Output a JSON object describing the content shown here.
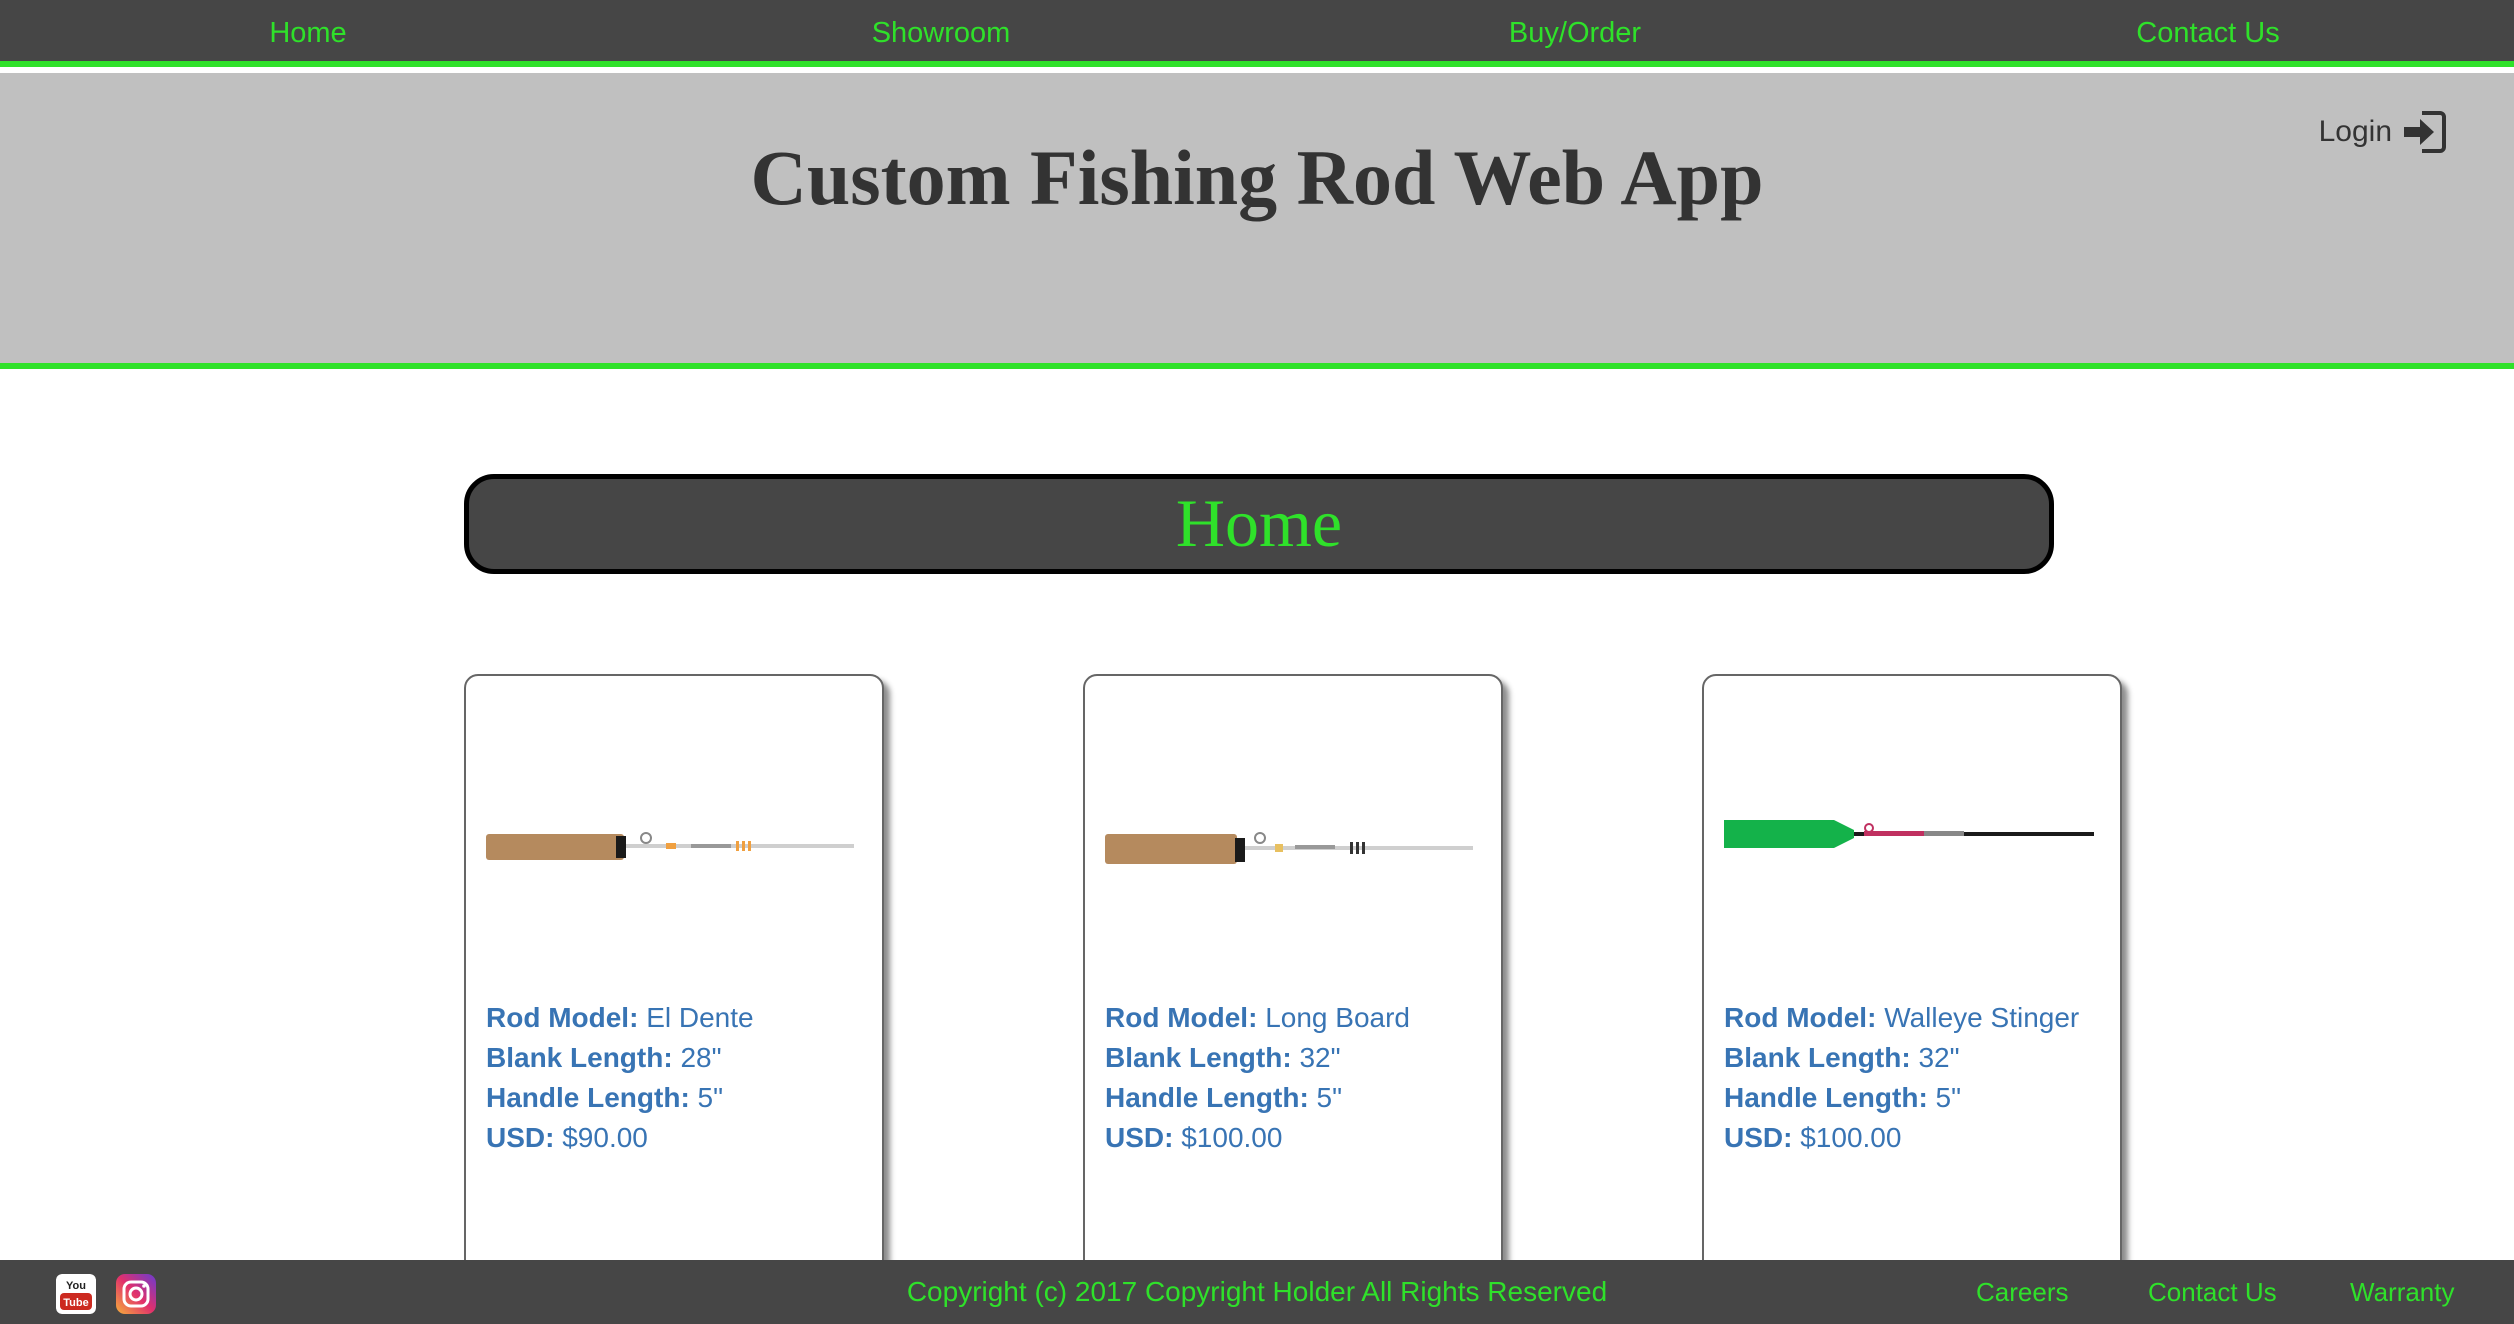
{
  "nav": {
    "home": "Home",
    "showroom": "Showroom",
    "buy_order": "Buy/Order",
    "contact": "Contact Us"
  },
  "header": {
    "title": "Custom Fishing Rod Web App",
    "login_label": "Login",
    "login_icon": "sign-in-icon"
  },
  "page": {
    "heading": "Home"
  },
  "labels": {
    "model": "Rod Model:",
    "blank": "Blank Length:",
    "handle": "Handle Length:",
    "usd": "USD:"
  },
  "products": [
    {
      "model": "El Dente",
      "blank_length": "28\"",
      "handle_length": "5\"",
      "price": "$90.00",
      "handle_style": "cork"
    },
    {
      "model": "Long Board",
      "blank_length": "32\"",
      "handle_length": "5\"",
      "price": "$100.00",
      "handle_style": "cork"
    },
    {
      "model": "Walleye Stinger",
      "blank_length": "32\"",
      "handle_length": "5\"",
      "price": "$100.00",
      "handle_style": "green"
    }
  ],
  "footer": {
    "copyright": "Copyright (c) 2017 Copyright Holder All Rights Reserved",
    "links": [
      "Careers",
      "Contact Us",
      "Warranty"
    ],
    "social_icons": [
      "youtube-icon",
      "instagram-icon"
    ]
  },
  "colors": {
    "accent": "#2fe12a",
    "dark": "#464646",
    "header_bg": "#c0c0c0",
    "text_blue": "#3874b4"
  }
}
